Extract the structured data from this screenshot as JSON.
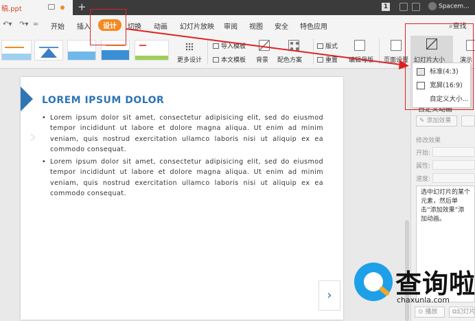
{
  "titlebar": {
    "doc_title": "稿.ppt",
    "new_tab": "+",
    "page_num": "1",
    "user": "Spacem..."
  },
  "menubar": {
    "items": [
      {
        "label": "开始"
      },
      {
        "label": "插入"
      },
      {
        "label": "设计",
        "active": true
      },
      {
        "label": "切换"
      },
      {
        "label": "动画"
      },
      {
        "label": "幻灯片放映"
      },
      {
        "label": "审阅"
      },
      {
        "label": "视图"
      },
      {
        "label": "安全"
      },
      {
        "label": "特色应用"
      }
    ],
    "search": "查找"
  },
  "ribbon": {
    "more_design": "更多设计",
    "import_template": "导入模板",
    "this_template": "本文模板",
    "background": "背景",
    "color_scheme": "配色方案",
    "layout": "版式",
    "rearrange": "重置",
    "edit_master": "编辑母版",
    "page_setup": "页面设置",
    "slide_size": "幻灯片大小",
    "presenter": "演示"
  },
  "dropdown": {
    "items": [
      {
        "label": "标准(4:3)",
        "selected": true
      },
      {
        "label": "宽屏(16:9)"
      },
      {
        "label": "自定义大小..."
      }
    ]
  },
  "slide": {
    "title": "LOREM IPSUM DOLOR",
    "bullets": [
      "Lorem ipsum dolor sit amet, consectetur adipisicing elit, sed do eiusmod tempor incididunt ut labore et dolore magna aliqua. Ut enim ad minim veniam, quis nostrud exercitation ullamco laboris nisi ut aliquip ex ea commodo consequat.",
      "Lorem ipsum dolor sit amet, consectetur adipisicing elit, sed do eiusmod tempor incididunt ut labore et dolore magna aliqua. Ut enim ad minim veniam, quis nostrud exercitation ullamco laboris nisi ut aliquip ex ea commodo consequat."
    ],
    "next": "›"
  },
  "panel": {
    "title": "自定义动画",
    "add_effect": "添加效果",
    "modify_effect": "修改效果",
    "start_label": "开始:",
    "property_label": "属性:",
    "speed_label": "速度:",
    "info_text": "选中幻灯片的某个元素，然后单击“添加效果”添加动画。",
    "play_button": "播放",
    "slideshow_button": "幻灯片"
  },
  "watermark": {
    "cn": "查询啦",
    "en": "chaxunla.com"
  },
  "colors": {
    "accent": "#f28b25",
    "slide_blue": "#2e75b6",
    "annotation_red": "#e02020",
    "title_red": "#d24726"
  }
}
